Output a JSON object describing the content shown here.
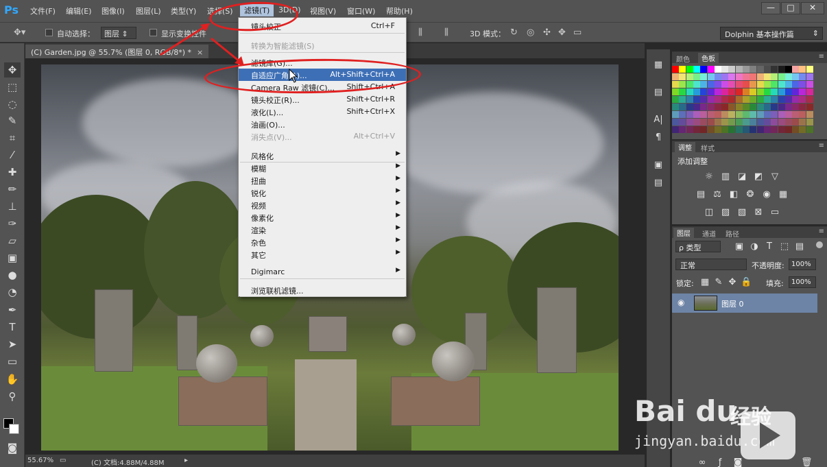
{
  "app": {
    "logo": "Ps",
    "menu": [
      "文件(F)",
      "编辑(E)",
      "图像(I)",
      "图层(L)",
      "类型(Y)",
      "选择(S)",
      "滤镜(T)",
      "3D(D)",
      "视图(V)",
      "窗口(W)",
      "帮助(H)"
    ],
    "window_controls": [
      "—",
      "□",
      "✕"
    ]
  },
  "options_bar": {
    "auto_select_label": "自动选择：",
    "auto_select_value": "图层",
    "show_transform_label": "显示变换控件",
    "mode_3d_label": "3D 模式：",
    "workspace": "Dolphin 基本操作篇"
  },
  "document": {
    "tab_title": "(C) Garden.jpg @ 55.7% (图层 0, RGB/8*) *",
    "close": "×"
  },
  "status": {
    "zoom": "55.67%",
    "doc_info": "(C) 文档:4.88M/4.88M"
  },
  "filter_menu": {
    "items": [
      {
        "label": "镜头校正",
        "shortcut": "Ctrl+F",
        "state": "normal"
      },
      {
        "label": "转换为智能滤镜(S)",
        "shortcut": "",
        "state": "disabled"
      },
      {
        "label": "滤镜库(G)...",
        "shortcut": "",
        "state": "normal"
      },
      {
        "label": "自适应广角(A)...",
        "shortcut": "Alt+Shift+Ctrl+A",
        "state": "highlight"
      },
      {
        "label": "Camera Raw 滤镜(C)...",
        "shortcut": "Shift+Ctrl+A",
        "state": "normal"
      },
      {
        "label": "镜头校正(R)...",
        "shortcut": "Shift+Ctrl+R",
        "state": "normal"
      },
      {
        "label": "液化(L)...",
        "shortcut": "Shift+Ctrl+X",
        "state": "normal"
      },
      {
        "label": "油画(O)...",
        "shortcut": "",
        "state": "normal"
      },
      {
        "label": "消失点(V)...",
        "shortcut": "Alt+Ctrl+V",
        "state": "disabled"
      },
      {
        "label": "风格化",
        "shortcut": "",
        "state": "submenu"
      },
      {
        "label": "模糊",
        "shortcut": "",
        "state": "submenu"
      },
      {
        "label": "扭曲",
        "shortcut": "",
        "state": "submenu"
      },
      {
        "label": "锐化",
        "shortcut": "",
        "state": "submenu"
      },
      {
        "label": "视频",
        "shortcut": "",
        "state": "submenu"
      },
      {
        "label": "像素化",
        "shortcut": "",
        "state": "submenu"
      },
      {
        "label": "渲染",
        "shortcut": "",
        "state": "submenu"
      },
      {
        "label": "杂色",
        "shortcut": "",
        "state": "submenu"
      },
      {
        "label": "其它",
        "shortcut": "",
        "state": "submenu"
      },
      {
        "label": "Digimarc",
        "shortcut": "",
        "state": "submenu"
      },
      {
        "label": "浏览联机滤镜...",
        "shortcut": "",
        "state": "normal"
      }
    ]
  },
  "panels": {
    "swatches_tabs": [
      "颜色",
      "色板"
    ],
    "adjust_tabs": [
      "调整",
      "样式"
    ],
    "adjust_title": "添加调整",
    "layers_tabs": [
      "图层",
      "通道",
      "路径"
    ],
    "layer_filter": "ρ 类型",
    "blend_mode": "正常",
    "opacity_label": "不透明度:",
    "opacity_value": "100%",
    "lock_label": "锁定:",
    "fill_label": "填充:",
    "fill_value": "100%",
    "layer_name": "图层 0"
  },
  "watermark": {
    "logo": "Bai du",
    "jingyan": "经验",
    "url": "jingyan.baidu.com"
  },
  "colors": {
    "accent_highlight": "#3d6fb6",
    "annotation_red": "#e02020",
    "selected_layer": "#6d84a6"
  }
}
